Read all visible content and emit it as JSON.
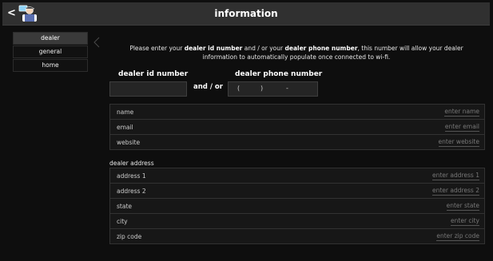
{
  "header": {
    "title": "information",
    "back_glyph": "<"
  },
  "sidebar": {
    "items": [
      {
        "label": "dealer"
      },
      {
        "label": "general"
      },
      {
        "label": "home"
      }
    ]
  },
  "intro": {
    "p1": "Please enter your ",
    "b1": "dealer id number",
    "p2": " and / or your ",
    "b2": "dealer phone number",
    "p3": ", this number will allow your dealer information to automatically populate once connected to wi-fi."
  },
  "dealer_id": {
    "label": "dealer id number",
    "value": ""
  },
  "and_or": "and / or",
  "dealer_phone": {
    "label": "dealer phone number",
    "open_paren": "(",
    "close_paren": ")",
    "dash": "-"
  },
  "contact_fields": [
    {
      "label": "name",
      "placeholder": "enter name"
    },
    {
      "label": "email",
      "placeholder": "enter email"
    },
    {
      "label": "website",
      "placeholder": "enter website"
    }
  ],
  "address_section": {
    "title": "dealer address",
    "fields": [
      {
        "label": "address 1",
        "placeholder": "enter address 1"
      },
      {
        "label": "address 2",
        "placeholder": "enter address 2"
      },
      {
        "label": "state",
        "placeholder": "enter state"
      },
      {
        "label": "city",
        "placeholder": "enter city"
      },
      {
        "label": "zip code",
        "placeholder": "enter zip code"
      }
    ]
  },
  "icons": {
    "back": "chevron-left-icon",
    "logo": "technician-laptop-logo",
    "collapse": "chevron-left-icon"
  },
  "colors": {
    "background": "#0e0e0e",
    "topbar": "#303030",
    "active_item": "#3a3a3a",
    "field_bg": "#252525"
  }
}
